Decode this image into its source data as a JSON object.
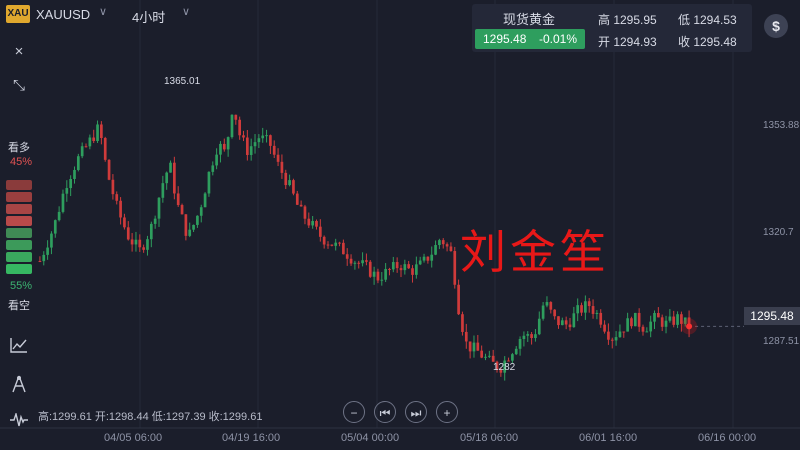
{
  "header": {
    "badge": "XAU",
    "symbol": "XAUUSD",
    "interval": "4小时",
    "caret": "∨"
  },
  "quote": {
    "name": "现货黄金",
    "price": "1295.48",
    "change": "-0.01%",
    "high": "高 1295.95",
    "low": "低 1294.53",
    "open": "开 1294.93",
    "close": "收 1295.48",
    "up_color": "#2e9e5e"
  },
  "toolbar": {
    "dollar": "$",
    "close": "×",
    "collapse": "⤡"
  },
  "sentiment": {
    "bull_label": "看多",
    "bull_pct": "45%",
    "bear_label": "看空",
    "bear_pct": "55%",
    "bull_color": "#e05252",
    "bear_color": "#3cb371"
  },
  "watermark": "刘金笙",
  "ohlc_line": "高:1299.61 开:1298.44 低:1297.39 收:1299.61",
  "navigation": {
    "zoom_out": "−",
    "prev": "⏮",
    "next": "⏭",
    "zoom_in": "+"
  },
  "chart_data": {
    "type": "candlestick",
    "title": "",
    "xlabel": "",
    "ylabel": "",
    "y_ticks": [
      "1353.88",
      "1320.7",
      "1287.51"
    ],
    "x_ticks": [
      "04/05 06:00",
      "04/19 16:00",
      "05/04 00:00",
      "05/18 06:00",
      "06/01 16:00",
      "06/16 00:00"
    ],
    "annotations": [
      {
        "label": "1365.01",
        "kind": "max"
      },
      {
        "label": "1282",
        "kind": "min"
      }
    ],
    "ylim": [
      1275,
      1375
    ],
    "last_price": "1295.48",
    "up_color": "#2e9e5e",
    "down_color": "#d03b3b",
    "path": [
      [
        0,
        1315
      ],
      [
        4,
        1326
      ],
      [
        7,
        1338
      ],
      [
        10,
        1345
      ],
      [
        13,
        1350
      ],
      [
        16,
        1355
      ],
      [
        18,
        1342
      ],
      [
        21,
        1330
      ],
      [
        24,
        1322
      ],
      [
        27,
        1318
      ],
      [
        30,
        1325
      ],
      [
        33,
        1338
      ],
      [
        35,
        1344
      ],
      [
        37,
        1332
      ],
      [
        40,
        1322
      ],
      [
        43,
        1330
      ],
      [
        46,
        1343
      ],
      [
        48,
        1350
      ],
      [
        50,
        1347
      ],
      [
        52,
        1362
      ],
      [
        54,
        1352
      ],
      [
        56,
        1348
      ],
      [
        59,
        1352
      ],
      [
        62,
        1350
      ],
      [
        64,
        1344
      ],
      [
        67,
        1338
      ],
      [
        70,
        1330
      ],
      [
        73,
        1326
      ],
      [
        76,
        1322
      ],
      [
        79,
        1320
      ],
      [
        82,
        1318
      ],
      [
        85,
        1315
      ],
      [
        88,
        1313
      ],
      [
        91,
        1310
      ],
      [
        94,
        1312
      ],
      [
        97,
        1314
      ],
      [
        100,
        1312
      ],
      [
        103,
        1314
      ],
      [
        106,
        1318
      ],
      [
        108,
        1322
      ],
      [
        111,
        1317
      ],
      [
        113,
        1300
      ],
      [
        115,
        1290
      ],
      [
        118,
        1288
      ],
      [
        121,
        1285
      ],
      [
        124,
        1283
      ],
      [
        127,
        1288
      ],
      [
        130,
        1293
      ],
      [
        133,
        1292
      ],
      [
        136,
        1303
      ],
      [
        139,
        1297
      ],
      [
        142,
        1296
      ],
      [
        145,
        1300
      ],
      [
        148,
        1302
      ],
      [
        151,
        1298
      ],
      [
        154,
        1292
      ],
      [
        157,
        1295
      ],
      [
        160,
        1298
      ],
      [
        163,
        1295
      ],
      [
        166,
        1298
      ],
      [
        169,
        1296
      ],
      [
        172,
        1298
      ],
      [
        175,
        1295.48
      ]
    ]
  }
}
